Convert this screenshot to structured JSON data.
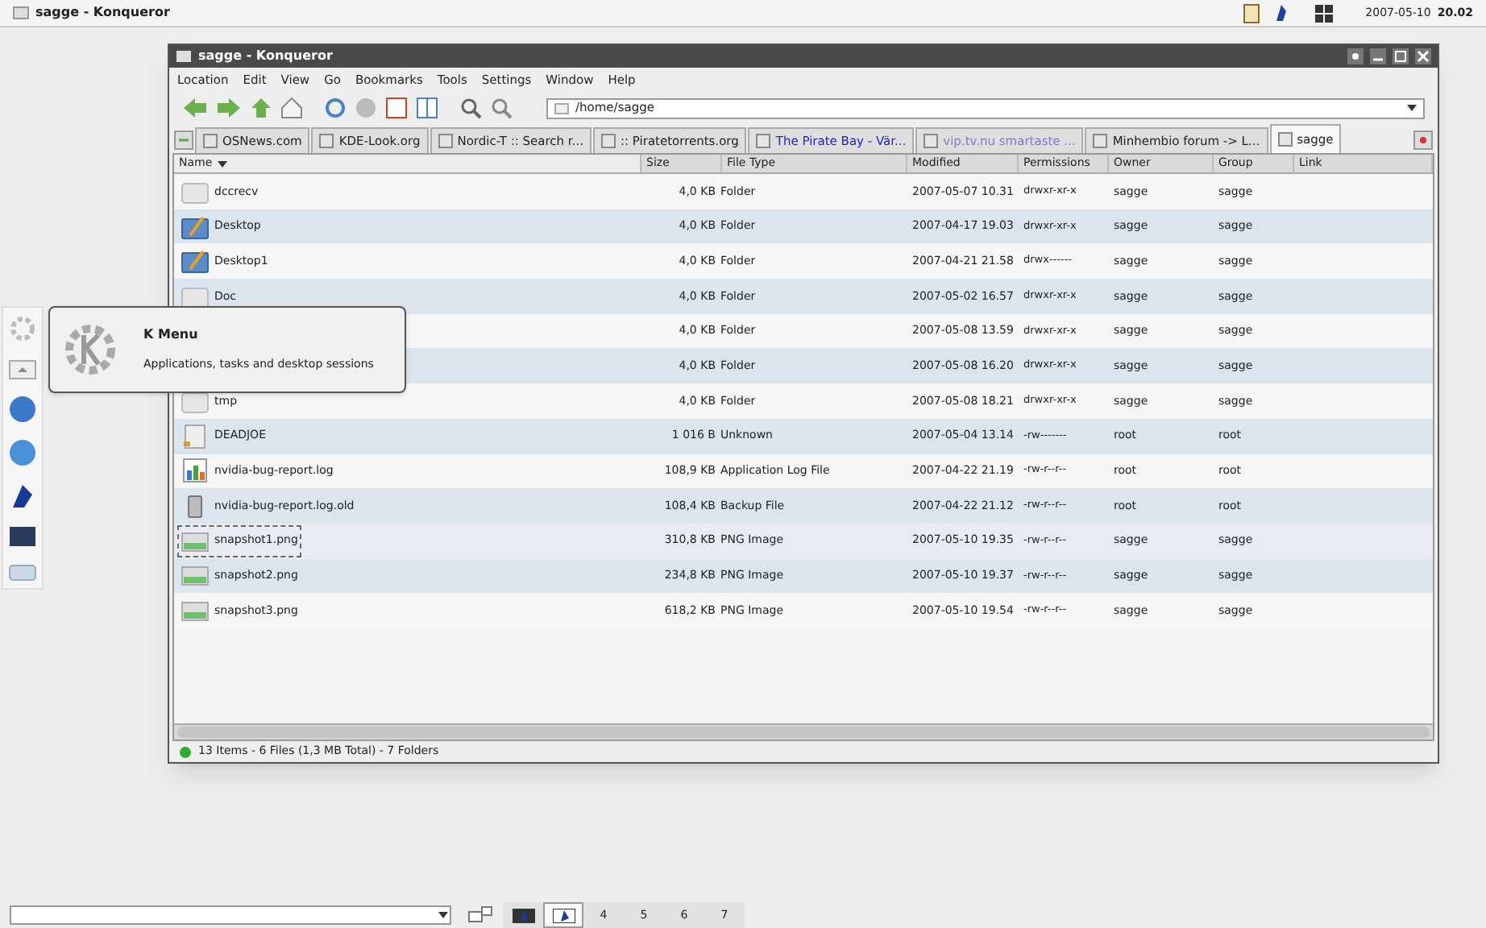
{
  "top_bar": {
    "active_window": "sagge - Konqueror",
    "date": "2007-05-10",
    "time": "20.02"
  },
  "window": {
    "title": "sagge - Konqueror",
    "menu": [
      "Location",
      "Edit",
      "View",
      "Go",
      "Bookmarks",
      "Tools",
      "Settings",
      "Window",
      "Help"
    ],
    "location": "/home/sagge",
    "tabs": [
      {
        "label": "OSNews.com",
        "selected": false,
        "color": "#222222"
      },
      {
        "label": "KDE-Look.org",
        "selected": false,
        "color": "#222222"
      },
      {
        "label": "Nordic-T :: Search r...",
        "selected": false,
        "color": "#222222"
      },
      {
        "label": ":: Piratetorrents.org",
        "selected": false,
        "color": "#222222"
      },
      {
        "label": "The Pirate Bay - Vär...",
        "selected": false,
        "color": "#2222cc"
      },
      {
        "label": "vip.tv.nu smartaste ...",
        "selected": false,
        "color": "#7a7ad0"
      },
      {
        "label": "Minhembio forum -> L...",
        "selected": false,
        "color": "#222222"
      },
      {
        "label": "sagge",
        "selected": true,
        "color": "#222222"
      }
    ],
    "columns": [
      {
        "label": "Name",
        "sorted": true
      },
      {
        "label": "Size",
        "sorted": false
      },
      {
        "label": "File Type",
        "sorted": false
      },
      {
        "label": "Modified",
        "sorted": false
      },
      {
        "label": "Permissions",
        "sorted": false
      },
      {
        "label": "Owner",
        "sorted": false
      },
      {
        "label": "Group",
        "sorted": false
      },
      {
        "label": "Link",
        "sorted": false
      }
    ],
    "rows": [
      {
        "kind": "folder",
        "name": "dccrecv",
        "size": "4,0 KB",
        "type": "Folder",
        "modified": "2007-05-07 10.31",
        "permissions": "drwxr-xr-x",
        "owner": "sagge",
        "group": "sagge",
        "selected": false
      },
      {
        "kind": "desktop",
        "name": "Desktop",
        "size": "4,0 KB",
        "type": "Folder",
        "modified": "2007-04-17 19.03",
        "permissions": "drwxr-xr-x",
        "owner": "sagge",
        "group": "sagge",
        "selected": false
      },
      {
        "kind": "desktop",
        "name": "Desktop1",
        "size": "4,0 KB",
        "type": "Folder",
        "modified": "2007-04-21 21.58",
        "permissions": "drwx------",
        "owner": "sagge",
        "group": "sagge",
        "selected": false
      },
      {
        "kind": "folder",
        "name": "Doc",
        "size": "4,0 KB",
        "type": "Folder",
        "modified": "2007-05-02 16.57",
        "permissions": "drwxr-xr-x",
        "owner": "sagge",
        "group": "sagge",
        "selected": false
      },
      {
        "kind": "hidden",
        "size": "4,0 KB",
        "type": "Folder",
        "modified": "2007-05-08 13.59",
        "permissions": "drwxr-xr-x",
        "owner": "sagge",
        "group": "sagge",
        "selected": false
      },
      {
        "kind": "hidden",
        "size": "4,0 KB",
        "type": "Folder",
        "modified": "2007-05-08 16.20",
        "permissions": "drwxr-xr-x",
        "owner": "sagge",
        "group": "sagge",
        "selected": false
      },
      {
        "kind": "folder",
        "name": "tmp",
        "size": "4,0 KB",
        "type": "Folder",
        "modified": "2007-05-08 18.21",
        "permissions": "drwxr-xr-x",
        "owner": "sagge",
        "group": "sagge",
        "selected": false
      },
      {
        "kind": "unknown",
        "name": "DEADJOE",
        "size": "1 016 B",
        "type": "Unknown",
        "modified": "2007-05-04 13.14",
        "permissions": "-rw-------",
        "owner": "root",
        "group": "root",
        "selected": false
      },
      {
        "kind": "log",
        "name": "nvidia-bug-report.log",
        "size": "108,9 KB",
        "type": "Application Log File",
        "modified": "2007-04-22 21.19",
        "permissions": "-rw-r--r--",
        "owner": "root",
        "group": "root",
        "selected": false
      },
      {
        "kind": "backup",
        "name": "nvidia-bug-report.log.old",
        "size": "108,4 KB",
        "type": "Backup File",
        "modified": "2007-04-22 21.12",
        "permissions": "-rw-r--r--",
        "owner": "root",
        "group": "root",
        "selected": false
      },
      {
        "kind": "image",
        "name": "snapshot1.png",
        "size": "310,8 KB",
        "type": "PNG Image",
        "modified": "2007-05-10 19.35",
        "permissions": "-rw-r--r--",
        "owner": "sagge",
        "group": "sagge",
        "selected": true
      },
      {
        "kind": "image",
        "name": "snapshot2.png",
        "size": "234,8 KB",
        "type": "PNG Image",
        "modified": "2007-05-10 19.37",
        "permissions": "-rw-r--r--",
        "owner": "sagge",
        "group": "sagge",
        "selected": false
      },
      {
        "kind": "image",
        "name": "snapshot3.png",
        "size": "618,2 KB",
        "type": "PNG Image",
        "modified": "2007-05-10 19.54",
        "permissions": "-rw-r--r--",
        "owner": "sagge",
        "group": "sagge",
        "selected": false
      }
    ],
    "status": "13 Items - 6 Files (1,3 MB Total) - 7 Folders"
  },
  "tooltip": {
    "title": "K Menu",
    "text": "Applications, tasks and desktop sessions"
  },
  "pager": [
    {
      "kind": "icon",
      "selected": false
    },
    {
      "kind": "icon",
      "selected": true
    },
    {
      "kind": "number",
      "label": "4",
      "selected": false
    },
    {
      "kind": "number",
      "label": "5",
      "selected": false
    },
    {
      "kind": "number",
      "label": "6",
      "selected": false
    },
    {
      "kind": "number",
      "label": "7",
      "selected": false
    }
  ]
}
